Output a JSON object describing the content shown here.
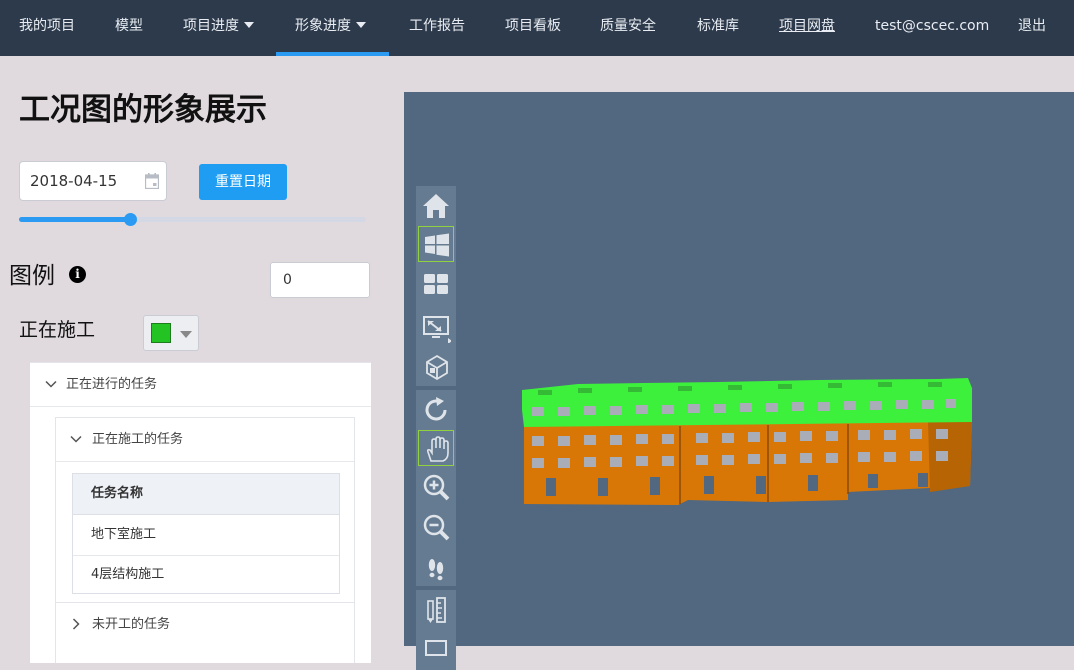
{
  "nav": {
    "items": [
      {
        "label": "我的项目"
      },
      {
        "label": "模型"
      },
      {
        "label": "项目进度"
      },
      {
        "label": "形象进度"
      },
      {
        "label": "工作报告"
      },
      {
        "label": "项目看板"
      },
      {
        "label": "质量安全"
      },
      {
        "label": "标准库"
      },
      {
        "label": "项目网盘"
      },
      {
        "label": "test@cscec.com"
      },
      {
        "label": "退出"
      }
    ],
    "active": "形象进度"
  },
  "page_title": "工况图的形象展示",
  "date_filter": {
    "value": "2018-04-15",
    "reset_label": "重置日期",
    "slider_value_percent": 32
  },
  "legend": {
    "title": "图例",
    "number_value": "0",
    "status_label": "正在施工",
    "status_color": "#22c322"
  },
  "tasks": {
    "in_progress_header": "正在进行的任务",
    "under_construction_header": "正在施工的任务",
    "table_header": "任务名称",
    "rows": [
      "地下室施工",
      "4层结构施工"
    ],
    "not_started_header": "未开工的任务"
  },
  "viewer": {
    "toolbar_icons": [
      "home-icon",
      "windows-view-icon",
      "layout-grid-icon",
      "fit-screen-icon",
      "cube-icon",
      "rotate-icon",
      "pan-hand-icon",
      "zoom-in-icon",
      "zoom-out-icon",
      "walk-icon",
      "measure-icon"
    ],
    "model_colors": {
      "in_progress": "#3cf03c",
      "built": "#d97706",
      "window": "#a9adb8"
    }
  }
}
